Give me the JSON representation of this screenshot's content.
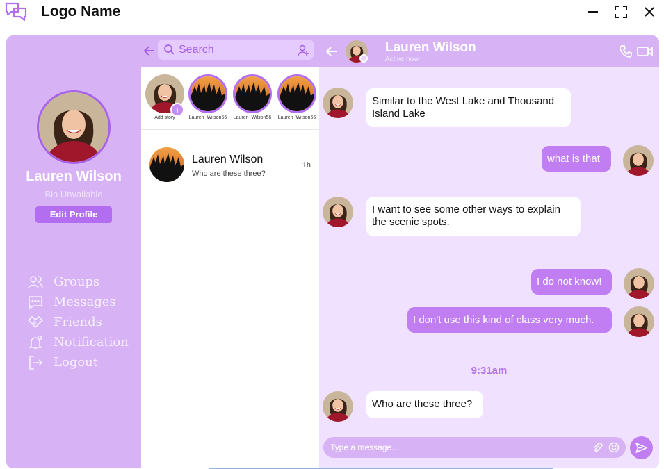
{
  "app": {
    "logo_name": "Logo Name"
  },
  "profile": {
    "name": "Lauren Wilson",
    "bio": "Bio Unvailable",
    "edit_label": "Edit Profile"
  },
  "nav": {
    "items": [
      {
        "label": "Groups",
        "icon": "groups-icon"
      },
      {
        "label": "Messages",
        "icon": "messages-icon"
      },
      {
        "label": "Friends",
        "icon": "friends-icon"
      },
      {
        "label": "Notification",
        "icon": "notification-icon"
      },
      {
        "label": "Logout",
        "icon": "logout-icon"
      }
    ]
  },
  "search": {
    "placeholder": "Search"
  },
  "stories": {
    "items": [
      {
        "label": "Add story"
      },
      {
        "label": "Lauren_Wilson56"
      },
      {
        "label": "Lauren_Wilson56"
      },
      {
        "label": "Lauren_Wilson56"
      }
    ]
  },
  "contacts": {
    "items": [
      {
        "name": "Lauren Wilson",
        "preview": "Who are these three?",
        "time": "1h"
      }
    ]
  },
  "chat": {
    "name": "Lauren Wilson",
    "status": "Active now",
    "messages": [
      {
        "dir": "in",
        "text": "Similar to the West Lake and Thousand Island Lake"
      },
      {
        "dir": "out",
        "text": "what is that"
      },
      {
        "dir": "in",
        "text": "I want to see some other ways to explain the scenic spots."
      },
      {
        "dir": "out",
        "text": "I do not know!"
      },
      {
        "dir": "out",
        "text": "I don't use this kind of class very much."
      },
      {
        "dir": "in",
        "text": "Who are these three?"
      }
    ],
    "time_separator": "9:31am",
    "composer_placeholder": "Type a message..."
  },
  "colors": {
    "accent": "#b26df0",
    "panel": "#d7b3f5",
    "chat_bg": "#efe1ff",
    "bubble_out": "#c17ef2"
  }
}
